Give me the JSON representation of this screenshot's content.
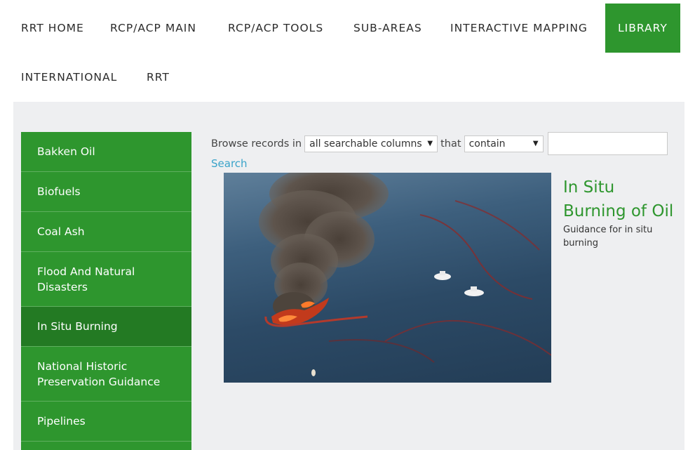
{
  "nav": {
    "items": [
      {
        "label": "RRT HOME"
      },
      {
        "label": "RCP/ACP MAIN"
      },
      {
        "label": "RCP/ACP TOOLS"
      },
      {
        "label": "SUB-AREAS"
      },
      {
        "label": "INTERACTIVE MAPPING"
      },
      {
        "label": "LIBRARY"
      },
      {
        "label": "INTERNATIONAL"
      },
      {
        "label": "RRT"
      }
    ],
    "active_color": "#2e962e"
  },
  "sidebar": {
    "items": [
      {
        "label": "Bakken Oil"
      },
      {
        "label": "Biofuels"
      },
      {
        "label": "Coal Ash"
      },
      {
        "label": "Flood And Natural Disasters"
      },
      {
        "label": "In Situ Burning"
      },
      {
        "label": "National Historic Preservation Guidance"
      },
      {
        "label": "Pipelines"
      }
    ],
    "active": "In Situ Burning",
    "color": "#2e962e",
    "active_color": "#237a23"
  },
  "search": {
    "prefix": "Browse records in",
    "column_select": "all searchable columns",
    "middle": "that",
    "operator_select": "contain",
    "input_value": "",
    "link_label": "Search"
  },
  "feature": {
    "title": "In Situ Burning of Oil",
    "description": "Guidance for in situ burning",
    "image_icon": "oil-burn-photo"
  }
}
